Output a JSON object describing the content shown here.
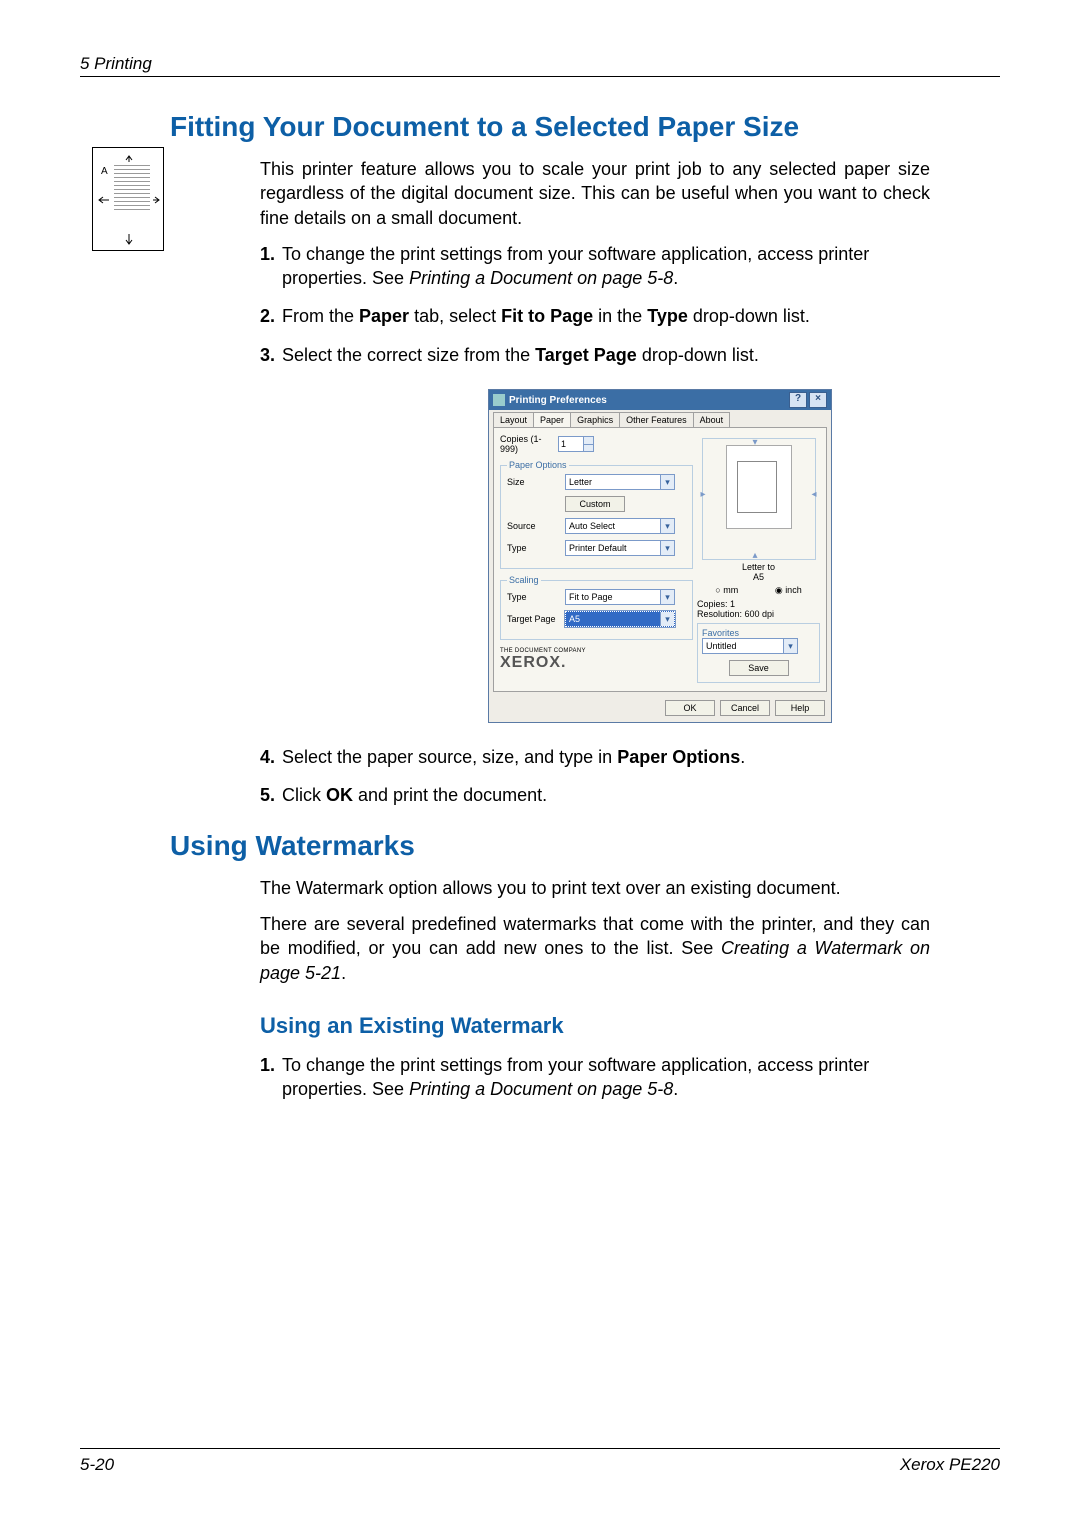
{
  "running_head": "5   Printing",
  "section1": {
    "heading": "Fitting Your Document to a Selected Paper Size",
    "intro": "This printer feature allows you to scale your print job to any selected paper size regardless of the digital document size. This can be useful when you want to check fine details on a small document.",
    "steps_a": [
      {
        "pre": "To change the print settings from your software application, access printer properties. See ",
        "ref": "Printing a Document on page 5-8",
        "post": "."
      },
      {
        "pre": "From the ",
        "b1": "Paper",
        "mid1": " tab, select ",
        "b2": "Fit to Page",
        "mid2": " in the ",
        "b3": "Type",
        "post": " drop-down list."
      },
      {
        "pre": "Select the correct size from the ",
        "b1": "Target Page",
        "post": " drop-down list."
      }
    ],
    "steps_b": [
      {
        "pre": "Select the paper source, size, and type in ",
        "b1": "Paper Options",
        "post": "."
      },
      {
        "pre": "Click ",
        "b1": "OK",
        "post": " and print the document."
      }
    ]
  },
  "section2": {
    "heading": "Using Watermarks",
    "p1": "The Watermark option allows you to print text over an existing document.",
    "p2_pre": "There are several predefined watermarks that come with the printer, and they can be modified, or you can add new ones to the list.  See ",
    "p2_ref": "Creating a Watermark on page 5-21",
    "p2_post": ".",
    "subheading": "Using an Existing Watermark",
    "steps": [
      {
        "pre": "To change the print settings from your software application, access printer properties. See ",
        "ref": "Printing a Document on page 5-8",
        "post": "."
      }
    ]
  },
  "dialog": {
    "title": "Printing Preferences",
    "tabs": [
      "Layout",
      "Paper",
      "Graphics",
      "Other Features",
      "About"
    ],
    "active_tab": "Paper",
    "copies_label": "Copies (1-999)",
    "copies_value": "1",
    "paper_options_legend": "Paper Options",
    "size_label": "Size",
    "size_value": "Letter",
    "custom_btn": "Custom",
    "source_label": "Source",
    "source_value": "Auto Select",
    "type_label": "Type",
    "type_value": "Printer Default",
    "scaling_legend": "Scaling",
    "scale_type_label": "Type",
    "scale_type_value": "Fit to Page",
    "target_label": "Target Page",
    "target_value": "A5",
    "preview_text": "Letter to\nA5",
    "unit_mm": "mm",
    "unit_inch": "inch",
    "info_copies": "Copies: 1",
    "info_res": "Resolution: 600 dpi",
    "fav_legend": "Favorites",
    "fav_value": "Untitled",
    "save_btn": "Save",
    "brand_caption": "THE DOCUMENT COMPANY",
    "brand": "XEROX.",
    "ok_btn": "OK",
    "cancel_btn": "Cancel",
    "help_btn": "Help"
  },
  "margin_fig_letter": "A",
  "footer": {
    "left": "5-20",
    "right": "Xerox PE220"
  }
}
